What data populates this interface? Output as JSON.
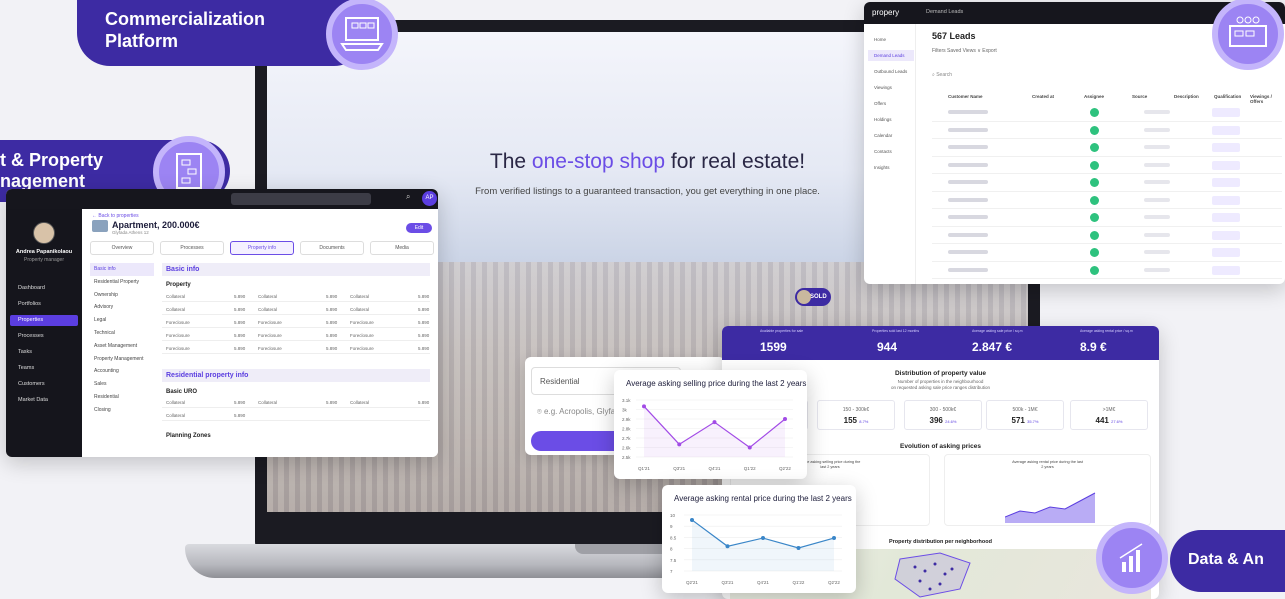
{
  "badges": {
    "commercialization": "Commercialization Platform",
    "asset": "t & Property\nnagement",
    "data": "Data & An"
  },
  "hero": {
    "title_prefix": "The ",
    "title_highlight": "one-stop shop",
    "title_suffix": " for real estate!",
    "subtitle": "From verified listings to a guaranteed transaction, you get everything in one place.",
    "search_select": "Residential",
    "search_placeholder": "e.g. Acropolis, Glyfada, A"
  },
  "sold_label": "SOLD",
  "dashboard": {
    "avatar": "AP",
    "user_name": "Andrea Papanikolaou",
    "user_role": "Property manager",
    "nav": [
      "Dashboard",
      "Portfolios",
      "Properties",
      "Processes",
      "Tasks",
      "Teams",
      "Customers",
      "Market Data"
    ],
    "back_link": "← Back to properties",
    "property_title": "Apartment, 200.000€",
    "property_address": "Glyfada Athens 12",
    "edit_label": "Edit",
    "tabs": [
      "Overview",
      "Processes",
      "Property info",
      "Documents",
      "Media"
    ],
    "subnav": [
      "Basic info",
      "Residential Property",
      "Ownership",
      "Advisory",
      "Legal",
      "Technical",
      "Asset Management",
      "Property Management",
      "Accounting",
      "Sales",
      "Residential",
      "Closing"
    ],
    "basic_info_header": "Basic info",
    "property_label": "Property",
    "rows": [
      [
        "Collateral",
        "5.890",
        "Collateral",
        "5.890",
        "Collateral",
        "5.890"
      ],
      [
        "Collateral",
        "5.890",
        "Collateral",
        "5.890",
        "Collateral",
        "5.890"
      ],
      [
        "Foreclosure",
        "5.890",
        "Foreclosure",
        "5.890",
        "Foreclosure",
        "5.890"
      ],
      [
        "Foreclosure",
        "5.890",
        "Foreclosure",
        "5.890",
        "Foreclosure",
        "5.890"
      ],
      [
        "Foreclosure",
        "5.890",
        "Foreclosure",
        "5.890",
        "Foreclosure",
        "5.890"
      ]
    ],
    "residential_header": "Residential property info",
    "basic_uro_label": "Basic URO",
    "uro_rows": [
      [
        "Collateral",
        "5.890",
        "Collateral",
        "5.890",
        "Collateral",
        "5.890"
      ],
      [
        "Collateral",
        "5.890",
        "",
        "",
        "",
        ""
      ]
    ],
    "planning_zones_label": "Planning Zones"
  },
  "leads": {
    "logo": "propery",
    "breadcrumb": "Demand Leads",
    "nav": [
      "Home",
      "Demand Leads",
      "Outbound Leads",
      "Viewings",
      "Offers",
      "Holdings",
      "Calendar",
      "Contacts",
      "Insights"
    ],
    "title": "567 Leads",
    "toolbar": "Filters    Saved Views ∨    Export",
    "search_placeholder": "Search",
    "columns": [
      "Customer Name",
      "Created at",
      "Assignee",
      "Source",
      "Description",
      "Qualification",
      "Viewings / Offers"
    ],
    "row_count": 10
  },
  "analytics": {
    "stats": [
      {
        "label": "Available properties for sale",
        "value": "1599"
      },
      {
        "label": "Properties sold last 12 months",
        "value": "944"
      },
      {
        "label": "Average asking sale price / sq.m",
        "value": "2.847 €"
      },
      {
        "label": "Average asking rental price / sq.m",
        "value": "8.9 €"
      }
    ],
    "distribution_title": "Distribution of property value",
    "distribution_sub": "Number of properties in the neighbourhood\non requested asking sale price ranges distribution",
    "buckets": [
      {
        "range": "",
        "value": "",
        "pct": ""
      },
      {
        "range": "150 - 300k€",
        "value": "155",
        "pct": "8.7%"
      },
      {
        "range": "300 - 500k€",
        "value": "396",
        "pct": "24.6%"
      },
      {
        "range": "500k - 1M€",
        "value": "571",
        "pct": "35.7%"
      },
      {
        "range": ">1M€",
        "value": "441",
        "pct": "27.6%"
      }
    ],
    "evolution_title": "Evolution of asking prices",
    "mini_left_title": "erage asking selling price during the\nlast 2 years",
    "mini_right_title": "Average asking rental price during the last\n2 years",
    "distribution_map_title": "Property distribution per neighborhood"
  },
  "chart_data": [
    {
      "type": "line",
      "title": "Average asking selling price during the last 2 years",
      "categories": [
        "Q1'21",
        "Q3'21",
        "Q4'21",
        "Q1'22",
        "Q2'22"
      ],
      "series": [
        {
          "values": [
            3.2,
            2.6,
            2.95,
            2.55,
            3.0
          ]
        }
      ],
      "yticks": [
        "3.1k",
        "3k",
        "2.9k",
        "2.8k",
        "2.7k",
        "2.6k",
        "2.5k"
      ],
      "ylim": [
        2.4,
        3.3
      ],
      "color": "#a24be6"
    },
    {
      "type": "line",
      "title": "Average asking rental price during the last 2 years",
      "categories": [
        "Q2'21",
        "Q3'21",
        "Q4'21",
        "Q1'22",
        "Q2'22"
      ],
      "series": [
        {
          "values": [
            9.9,
            8.3,
            8.8,
            8.2,
            8.8
          ]
        }
      ],
      "yticks": [
        "10",
        "9",
        "8.5",
        "8",
        "7.5",
        "7"
      ],
      "ylim": [
        6.8,
        10.2
      ],
      "color": "#3a86c8"
    }
  ]
}
